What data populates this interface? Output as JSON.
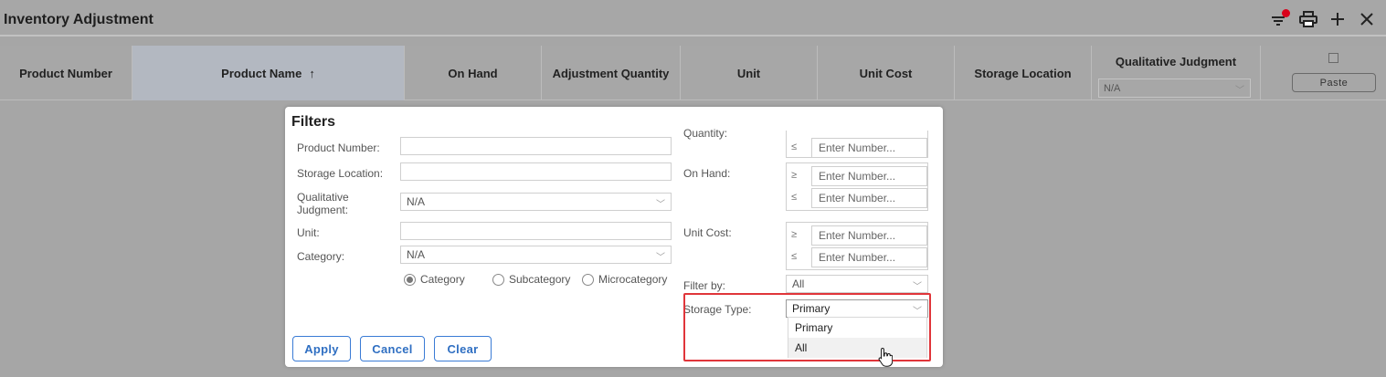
{
  "window": {
    "title": "Inventory Adjustment",
    "icons": [
      "filter-icon",
      "print-icon",
      "add-icon",
      "close-icon"
    ],
    "filter_active_color": "#d9001b"
  },
  "table": {
    "columns": [
      {
        "label": "Product Number"
      },
      {
        "label": "Product Name",
        "sort": "asc",
        "sort_glyph": "↑"
      },
      {
        "label": "On Hand"
      },
      {
        "label": "Adjustment Quantity"
      },
      {
        "label": "Unit"
      },
      {
        "label": "Unit Cost"
      },
      {
        "label": "Storage Location"
      },
      {
        "label": "Qualitative Judgment",
        "filter_value": "N/A"
      }
    ],
    "paste_label": "Paste"
  },
  "filters": {
    "title": "Filters",
    "product_number_label": "Product Number:",
    "storage_location_label": "Storage Location:",
    "qualitative_judgment_label": "Qualitative Judgment:",
    "qualitative_judgment_value": "N/A",
    "unit_label": "Unit:",
    "category_label": "Category:",
    "category_value": "N/A",
    "radios": [
      {
        "label": "Category",
        "checked": true
      },
      {
        "label": "Subcategory",
        "checked": false
      },
      {
        "label": "Microcategory",
        "checked": false
      }
    ],
    "quantity_label": "Quantity:",
    "on_hand_label": "On Hand:",
    "unit_cost_label": "Unit Cost:",
    "filter_by_label": "Filter by:",
    "filter_by_value": "All",
    "storage_type_label": "Storage Type:",
    "storage_type_value": "Primary",
    "storage_type_options": [
      "Primary",
      "All"
    ],
    "number_placeholder": "Enter Number...",
    "op_gte": "≥",
    "op_lte": "≤",
    "buttons": {
      "apply": "Apply",
      "cancel": "Cancel",
      "clear": "Clear"
    }
  },
  "colors": {
    "accent": "#2f6fc2",
    "highlight": "#e0353a",
    "overlay": "#a6a6a6"
  }
}
